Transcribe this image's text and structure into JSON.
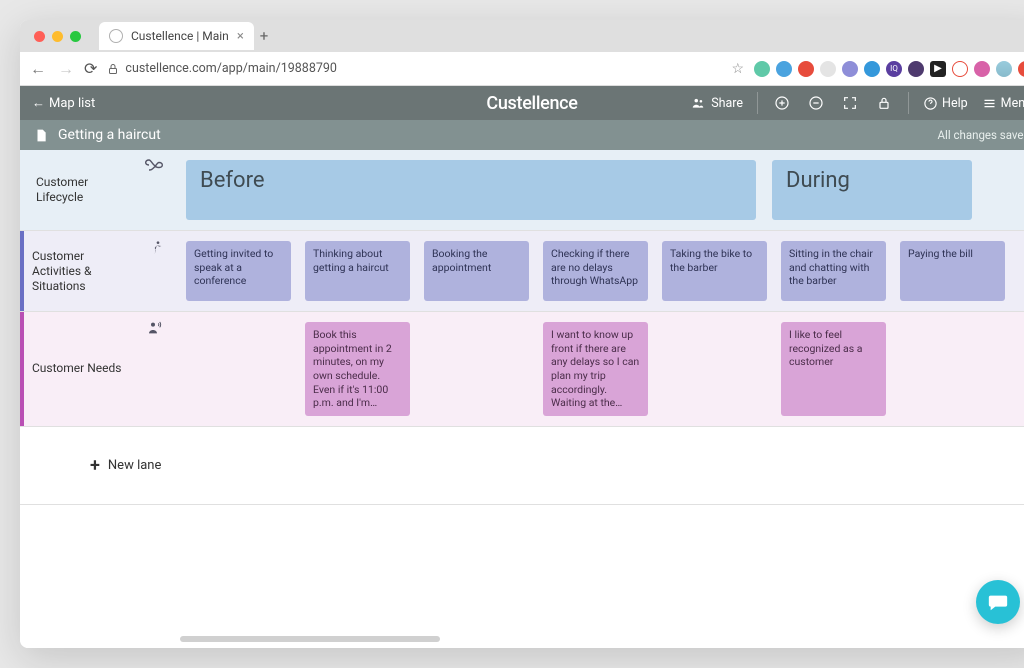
{
  "browser": {
    "tab_title": "Custellence | Main",
    "url": "custellence.com/app/main/19888790"
  },
  "topbar": {
    "back_label": "Map list",
    "brand": "Custellence",
    "share_label": "Share",
    "help_label": "Help",
    "menu_label": "Menu"
  },
  "titlebar": {
    "map_name": "Getting a haircut",
    "saved_status": "All changes saved"
  },
  "lanes": {
    "lifecycle_label": "Customer Lifecycle",
    "activities_label": "Customer Activities & Situations",
    "needs_label": "Customer Needs",
    "new_lane_label": "New lane"
  },
  "phases": {
    "before": "Before",
    "during": "During"
  },
  "activities": [
    "Getting invited to speak at a conference",
    "Thinking about getting a haircut",
    "Booking the appointment",
    "Checking if there are no delays through WhatsApp",
    "Taking the bike to the barber",
    "Sitting in the chair and chatting with the barber",
    "Paying the bill"
  ],
  "needs": {
    "1": "Book this appointment in 2 minutes, on my own schedule. Even if it's 11:00 p.m. and I'm…",
    "3": "I want to know up front if there are any delays so I can plan my trip accordingly. Waiting at the…",
    "5": "I like to feel recognized as a customer"
  }
}
